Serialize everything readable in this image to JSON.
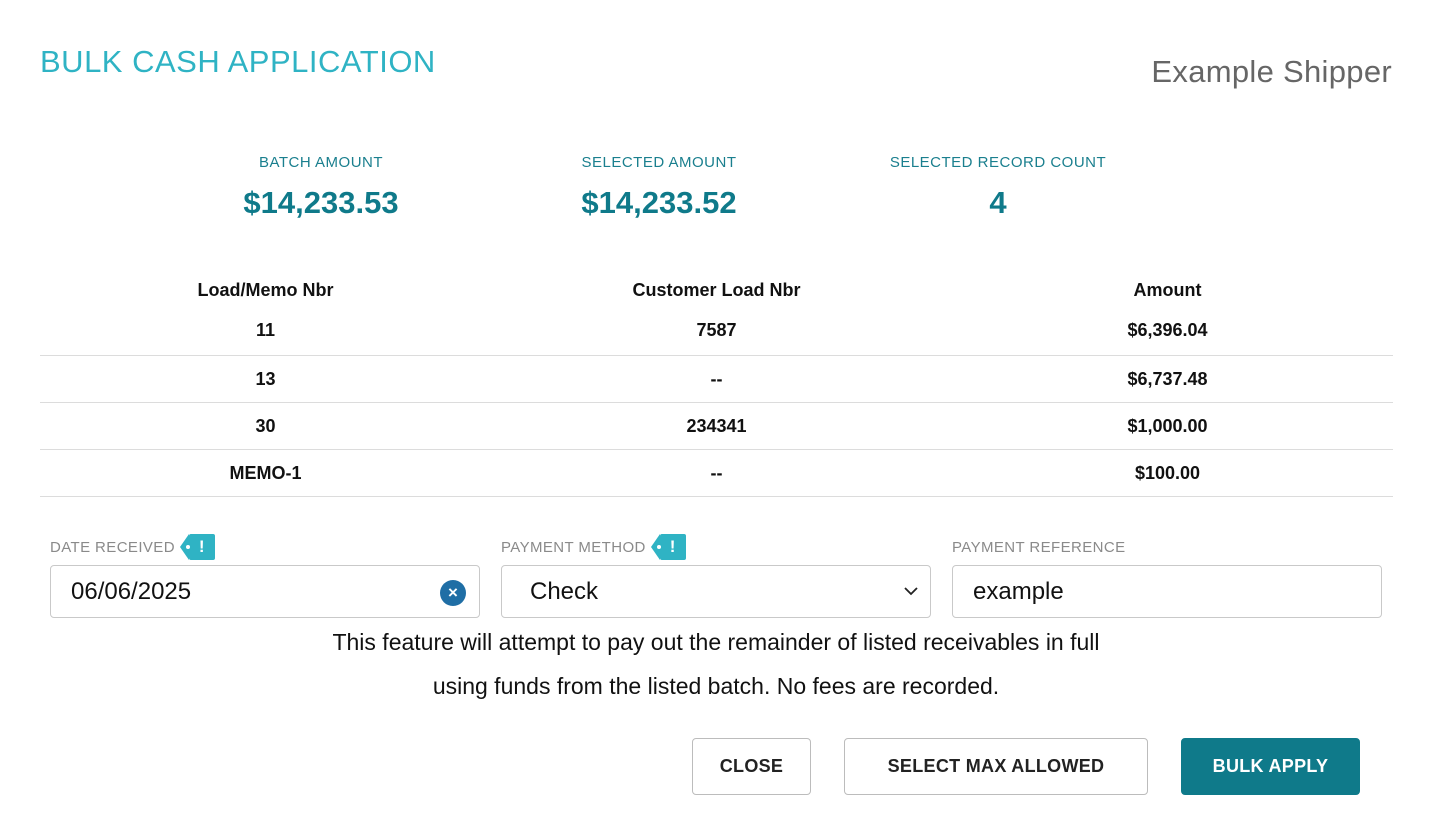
{
  "header": {
    "title": "BULK CASH APPLICATION",
    "shipper": "Example Shipper"
  },
  "summary": {
    "batch_amount_label": "BATCH AMOUNT",
    "batch_amount_value": "$14,233.53",
    "selected_amount_label": "SELECTED AMOUNT",
    "selected_amount_value": "$14,233.52",
    "record_count_label": "SELECTED RECORD COUNT",
    "record_count_value": "4"
  },
  "table": {
    "headers": [
      "Load/Memo Nbr",
      "Customer Load Nbr",
      "Amount"
    ],
    "rows": [
      [
        "11",
        "7587",
        "$6,396.04"
      ],
      [
        "13",
        "--",
        "$6,737.48"
      ],
      [
        "30",
        "234341",
        "$1,000.00"
      ],
      [
        "MEMO-1",
        "--",
        "$100.00"
      ]
    ]
  },
  "form": {
    "date_received_label": "DATE RECEIVED",
    "date_received_value": "06/06/2025",
    "payment_method_label": "PAYMENT METHOD",
    "payment_method_value": "Check",
    "payment_reference_label": "PAYMENT REFERENCE",
    "payment_reference_value": "example",
    "warning_glyph": "!"
  },
  "note": {
    "line1": "This feature will attempt to pay out the remainder of listed receivables in full",
    "line2": "using funds from the listed batch. No fees are recorded."
  },
  "buttons": {
    "close": "CLOSE",
    "select_max": "SELECT MAX ALLOWED",
    "bulk_apply": "BULK APPLY"
  },
  "icons": {
    "clear": "×"
  },
  "colors": {
    "accent": "#2fb3c4",
    "primary": "#0f7a8a",
    "clear_icon": "#1f6ea5"
  }
}
